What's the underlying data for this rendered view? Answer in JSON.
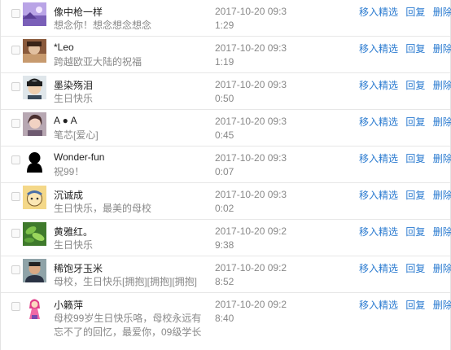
{
  "actions": {
    "feature": "移入精选",
    "reply": "回复",
    "delete": "删除"
  },
  "comments": [
    {
      "name": "像中枪一样",
      "message": "想念你！想念想念想念",
      "time_line1": "2017-10-20 09:3",
      "time_line2": "1:29",
      "avatar": "purple-landscape"
    },
    {
      "name": "*Leo",
      "message": "跨越欧亚大陆的祝福",
      "time_line1": "2017-10-20 09:3",
      "time_line2": "1:19",
      "avatar": "brown-portrait"
    },
    {
      "name": "墨染殇泪",
      "message": "生日快乐",
      "time_line1": "2017-10-20 09:3",
      "time_line2": "0:50",
      "avatar": "dark-hair-boy"
    },
    {
      "name": "A ● A",
      "message": "笔芯[爱心]",
      "time_line1": "2017-10-20 09:3",
      "time_line2": "0:45",
      "avatar": "girl-selfie"
    },
    {
      "name": "Wonder-fun",
      "message": "祝99！",
      "time_line1": "2017-10-20 09:3",
      "time_line2": "0:07",
      "avatar": "black-silhouette"
    },
    {
      "name": "沉诚成",
      "message": "生日快乐，最美的母校",
      "time_line1": "2017-10-20 09:3",
      "time_line2": "0:02",
      "avatar": "cartoon-face"
    },
    {
      "name": "黄雅红。",
      "message": "生日快乐",
      "time_line1": "2017-10-20 09:2",
      "time_line2": "9:38",
      "avatar": "green-leaves"
    },
    {
      "name": "稀饱牙玉米",
      "message": "母校，生日快乐[拥抱][拥抱][拥抱]",
      "time_line1": "2017-10-20 09:2",
      "time_line2": "8:52",
      "avatar": "man-portrait"
    },
    {
      "name": "小籁萍",
      "message": "母校99岁生日快乐咯，母校永远有忘不了的回忆，最爱你，09级学长",
      "time_line1": "2017-10-20 09:2",
      "time_line2": "8:40",
      "avatar": "anime-girl"
    }
  ]
}
